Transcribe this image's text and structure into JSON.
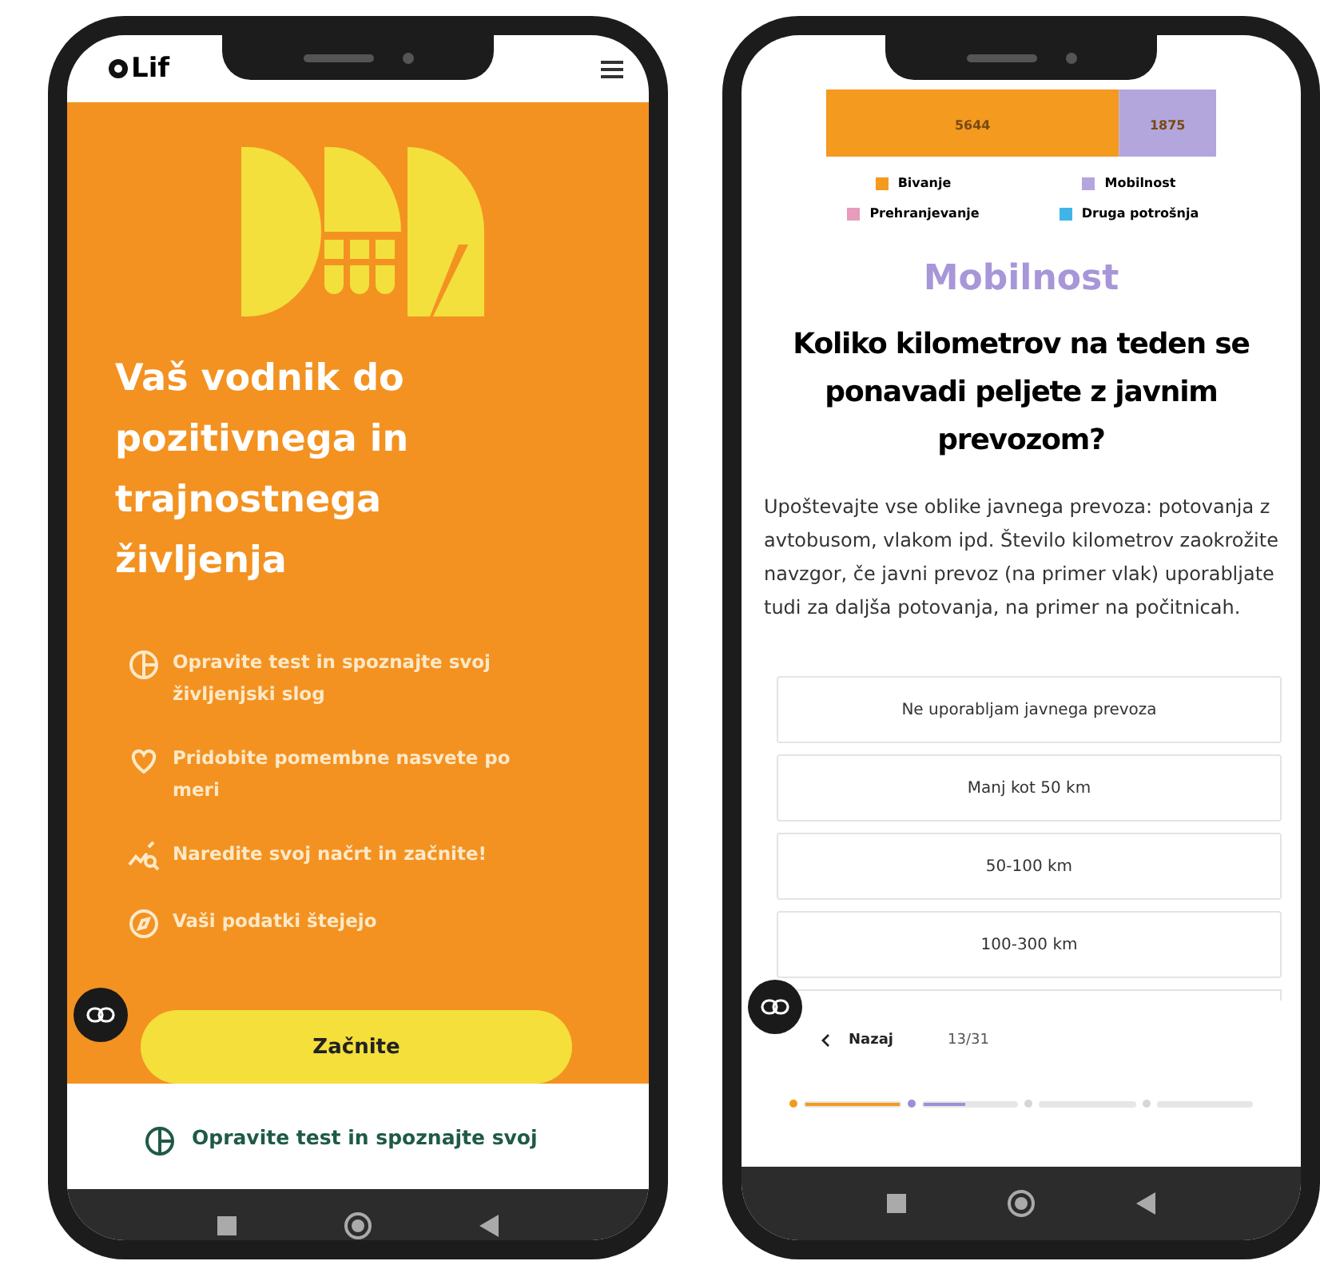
{
  "left_phone": {
    "header": {
      "logo_text": "Lif"
    },
    "hero": {
      "title": "Vaš vodnik do pozitivnega in trajnostnega življenja",
      "features": [
        {
          "kind": "pie",
          "text": "Opravite test in spoznajte svoj življenjski slog"
        },
        {
          "kind": "heart",
          "text": "Pridobite pomembne nasvete po meri"
        },
        {
          "kind": "chart",
          "text": "Naredite svoj načrt in začnite!"
        },
        {
          "kind": "compass",
          "text": "Vaši podatki štejejo"
        }
      ],
      "start_button": "Začnite"
    },
    "below": {
      "kind": "pie",
      "text": "Opravite test in spoznajte svoj"
    }
  },
  "right_phone": {
    "chart_data": {
      "type": "bar",
      "orientation": "horizontal",
      "stacked": true,
      "data_labels": true,
      "series": [
        {
          "name": "Bivanje",
          "color": "#f39a1f",
          "values": [
            5644
          ]
        },
        {
          "name": "Mobilnost",
          "color": "#b3a6dd",
          "values": [
            1875
          ]
        },
        {
          "name": "Prehranjevanje",
          "color": "#e79bbd",
          "values": [
            null
          ]
        },
        {
          "name": "Druga potrošnja",
          "color": "#41b4e6",
          "values": [
            null
          ]
        }
      ]
    },
    "category": "Mobilnost",
    "question": "Koliko kilometrov na teden se ponavadi peljete z javnim prevozom?",
    "description": "Upoštevajte vse oblike javnega prevoza: potovanja z avtobusom, vlakom ipd. Število kilometrov zaokrožite navzgor, če javni prevoz (na primer vlak) uporabljate tudi za daljša potovanja, na primer na počitnicah.",
    "options": [
      "Ne uporabljam javnega prevoza",
      "Manj kot 50 km",
      "50-100 km",
      "100-300 km"
    ],
    "back_button": "Nazaj",
    "page_counter": "13/31",
    "progress_segments": [
      {
        "color": "#f39a1f",
        "level": 1
      },
      {
        "color": "#9d8fd6",
        "level": 0.45
      },
      {
        "level": 0
      },
      {
        "level": 0
      }
    ]
  }
}
